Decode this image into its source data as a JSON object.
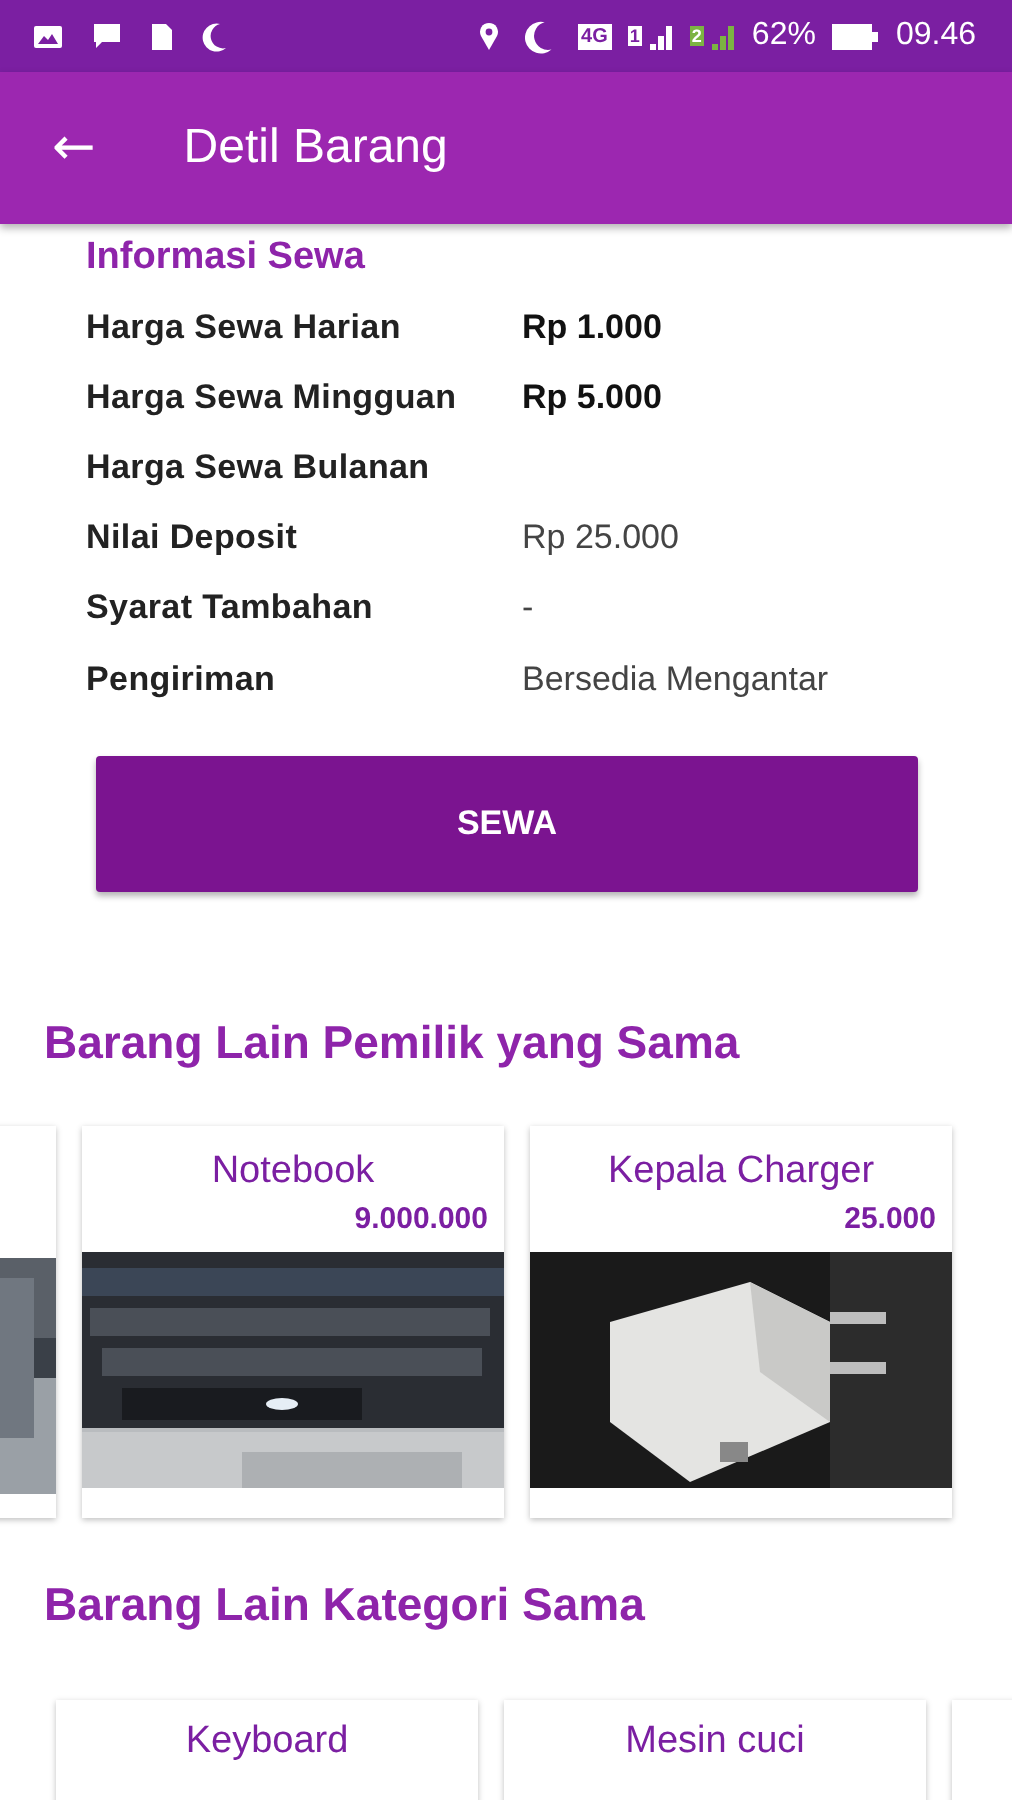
{
  "status_bar": {
    "network": "4G",
    "sim_1": "1",
    "sim_2": "2",
    "battery": "62%",
    "time": "09.46"
  },
  "app_bar": {
    "back": "←",
    "title": "Detil Barang"
  },
  "rental_info": {
    "heading": "Informasi Sewa",
    "rows": [
      {
        "label": "Harga Sewa Harian",
        "value": "Rp 1.000",
        "bold": true
      },
      {
        "label": "Harga Sewa Mingguan",
        "value": "Rp 5.000",
        "bold": true
      },
      {
        "label": "Harga Sewa Bulanan"
      },
      {
        "label": "Nilai Deposit",
        "value": "Rp 25.000",
        "bold": false
      },
      {
        "label": "Syarat Tambahan",
        "value": "-",
        "bold": false
      },
      {
        "label": "Pengiriman",
        "value": "Bersedia Mengantar",
        "bold": false
      }
    ]
  },
  "rent_button": "SEWA",
  "same_owner": {
    "heading": "Barang Lain Pemilik yang Sama",
    "items": [
      {
        "kind": "picture"
      },
      {
        "title": "Notebook",
        "price": "9.000.000",
        "kind": "picture"
      },
      {
        "title": "Kepala Charger",
        "price": "25.000",
        "kind": "picture"
      }
    ]
  },
  "same_category": {
    "heading": "Barang Lain Kategori Sama",
    "items": [
      {
        "title": "Keyboard",
        "kind": "card"
      },
      {
        "title": "Mesin cuci",
        "kind": "card"
      },
      {
        "kind": "stub"
      }
    ]
  }
}
